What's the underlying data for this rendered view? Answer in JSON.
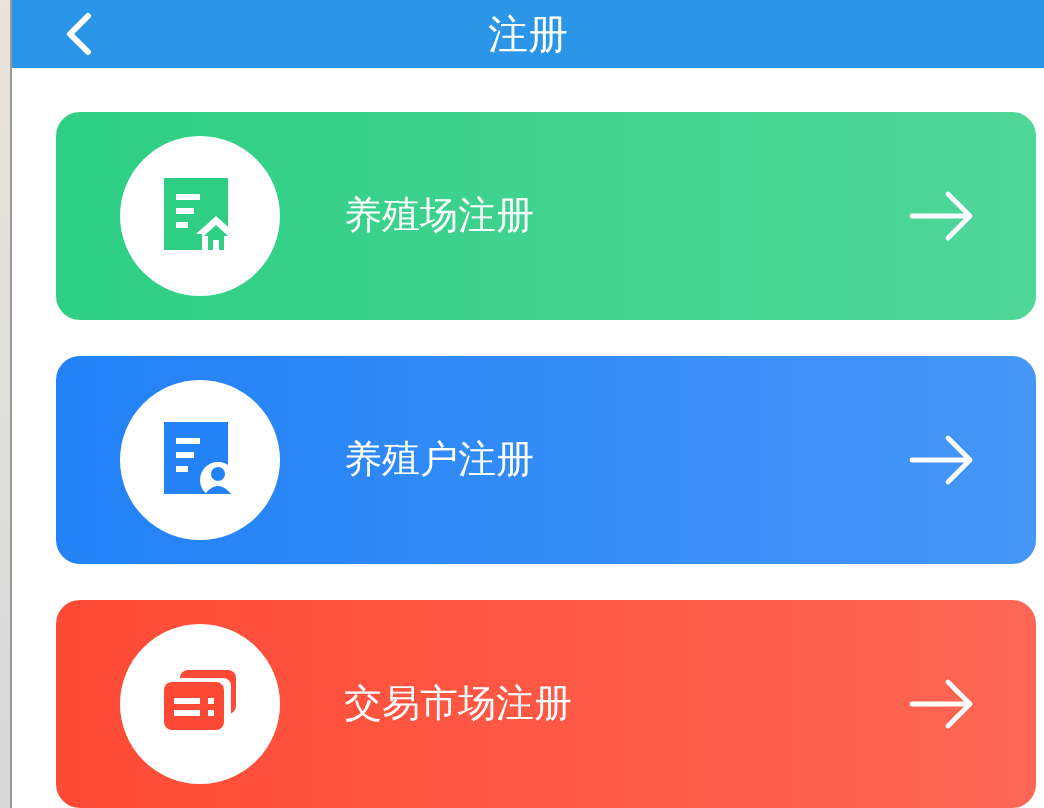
{
  "header": {
    "title": "注册"
  },
  "cards": [
    {
      "label": "养殖场注册",
      "kind": "farm",
      "color": "#2ecf85"
    },
    {
      "label": "养殖户注册",
      "kind": "farmer",
      "color": "#2282f6"
    },
    {
      "label": "交易市场注册",
      "kind": "market",
      "color": "#fe4a35"
    }
  ]
}
